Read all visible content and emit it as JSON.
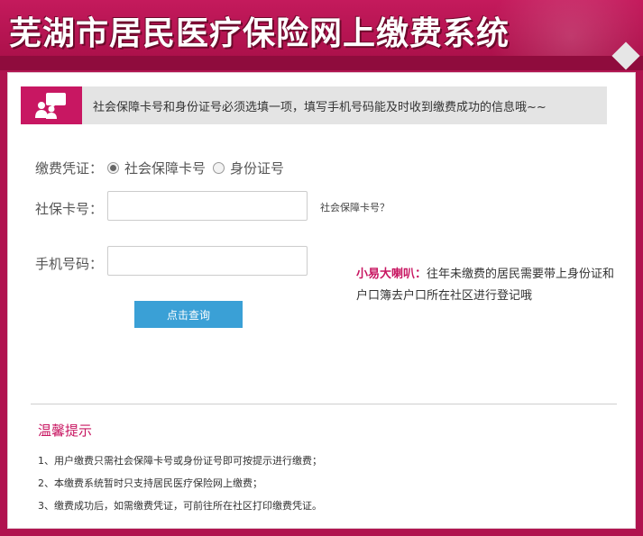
{
  "header": {
    "title": "芜湖市居民医疗保险网上缴费系统"
  },
  "notice": {
    "icon": "users-chat-icon",
    "text": "社会保障卡号和身份证号必须选填一项，填写手机号码能及时收到缴费成功的信息哦~~"
  },
  "form": {
    "voucher_label": "缴费凭证：",
    "options": [
      {
        "label": "社会保障卡号",
        "checked": true
      },
      {
        "label": "身份证号",
        "checked": false
      }
    ],
    "card_label": "社保卡号：",
    "card_value": "",
    "card_hint": "社会保障卡号？",
    "phone_label": "手机号码：",
    "phone_value": "",
    "submit_label": "点击查询"
  },
  "promo": {
    "title": "小易大喇叭：",
    "text": "往年未缴费的居民需要带上身份证和户口簿去户口所在社区进行登记哦"
  },
  "tips": {
    "title": "温馨提示",
    "items": [
      "1、用户缴费只需社会保障卡号或身份证号即可按提示进行缴费；",
      "2、本缴费系统暂时只支持居民医疗保险网上缴费；",
      "3、缴费成功后，如需缴费凭证，可前往所在社区打印缴费凭证。"
    ]
  },
  "colors": {
    "brand": "#c81762",
    "header": "#b0134f",
    "button": "#3aa0d6"
  }
}
